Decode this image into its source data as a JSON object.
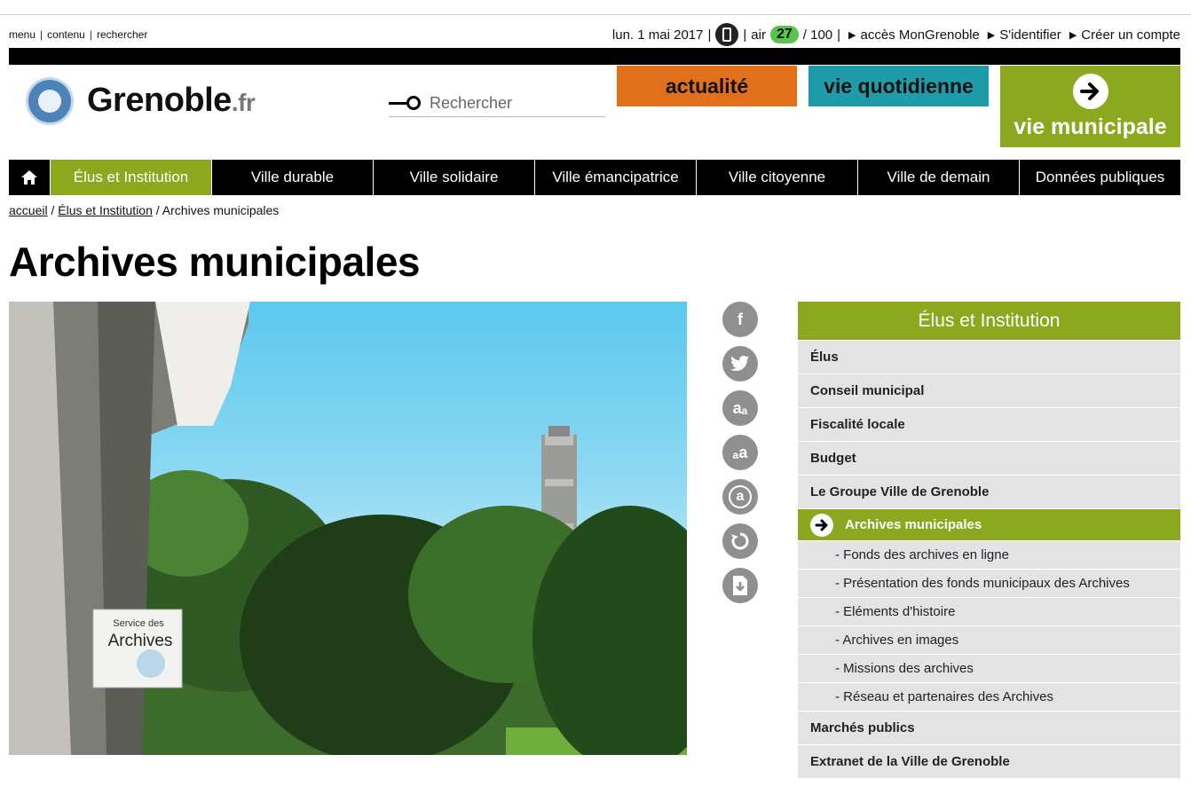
{
  "utility": {
    "skip_links": [
      "menu",
      "contenu",
      "rechercher"
    ],
    "date": "lun. 1 mai 2017",
    "air_label": "air",
    "air_value": "27",
    "air_max": "/ 100",
    "links": [
      "accès MonGrenoble",
      "S'identifier",
      "Créer un compte"
    ]
  },
  "brand": {
    "name": "Grenoble",
    "tld": ".fr",
    "seal_alt": "Ville de Grenoble"
  },
  "search": {
    "placeholder": "Rechercher"
  },
  "categories": {
    "actualite": "actualité",
    "vie_quotidienne": "vie quotidienne",
    "vie_municipale": "vie municipale"
  },
  "nav": {
    "items": [
      "Élus et Institution",
      "Ville durable",
      "Ville solidaire",
      "Ville émancipatrice",
      "Ville citoyenne",
      "Ville de demain",
      "Données publiques"
    ]
  },
  "breadcrumb": {
    "home": "accueil",
    "section": "Élus et Institution",
    "current": "Archives municipales"
  },
  "page": {
    "title": "Archives municipales"
  },
  "hero": {
    "sign_line1": "Service des",
    "sign_line2": "Archives"
  },
  "tools": {
    "facebook": "f",
    "text_smaller": "aₐ",
    "text_larger": "ₐa",
    "contrast": "a"
  },
  "sidenav": {
    "title": "Élus et Institution",
    "items": [
      "Élus",
      "Conseil municipal",
      "Fiscalité locale",
      "Budget",
      "Le Groupe Ville de Grenoble"
    ],
    "active": "Archives municipales",
    "subitems": [
      "- Fonds des archives en ligne",
      "- Présentation des fonds municipaux des Archives",
      "- Eléments d'histoire",
      "- Archives en images",
      "- Missions des archives",
      "- Réseau et partenaires des Archives"
    ],
    "after": [
      "Marchés publics",
      "Extranet de la Ville de Grenoble"
    ]
  },
  "colors": {
    "green": "#8ba81f",
    "orange": "#e0701c",
    "teal": "#1f9caa",
    "air_badge": "#5cc24f"
  }
}
